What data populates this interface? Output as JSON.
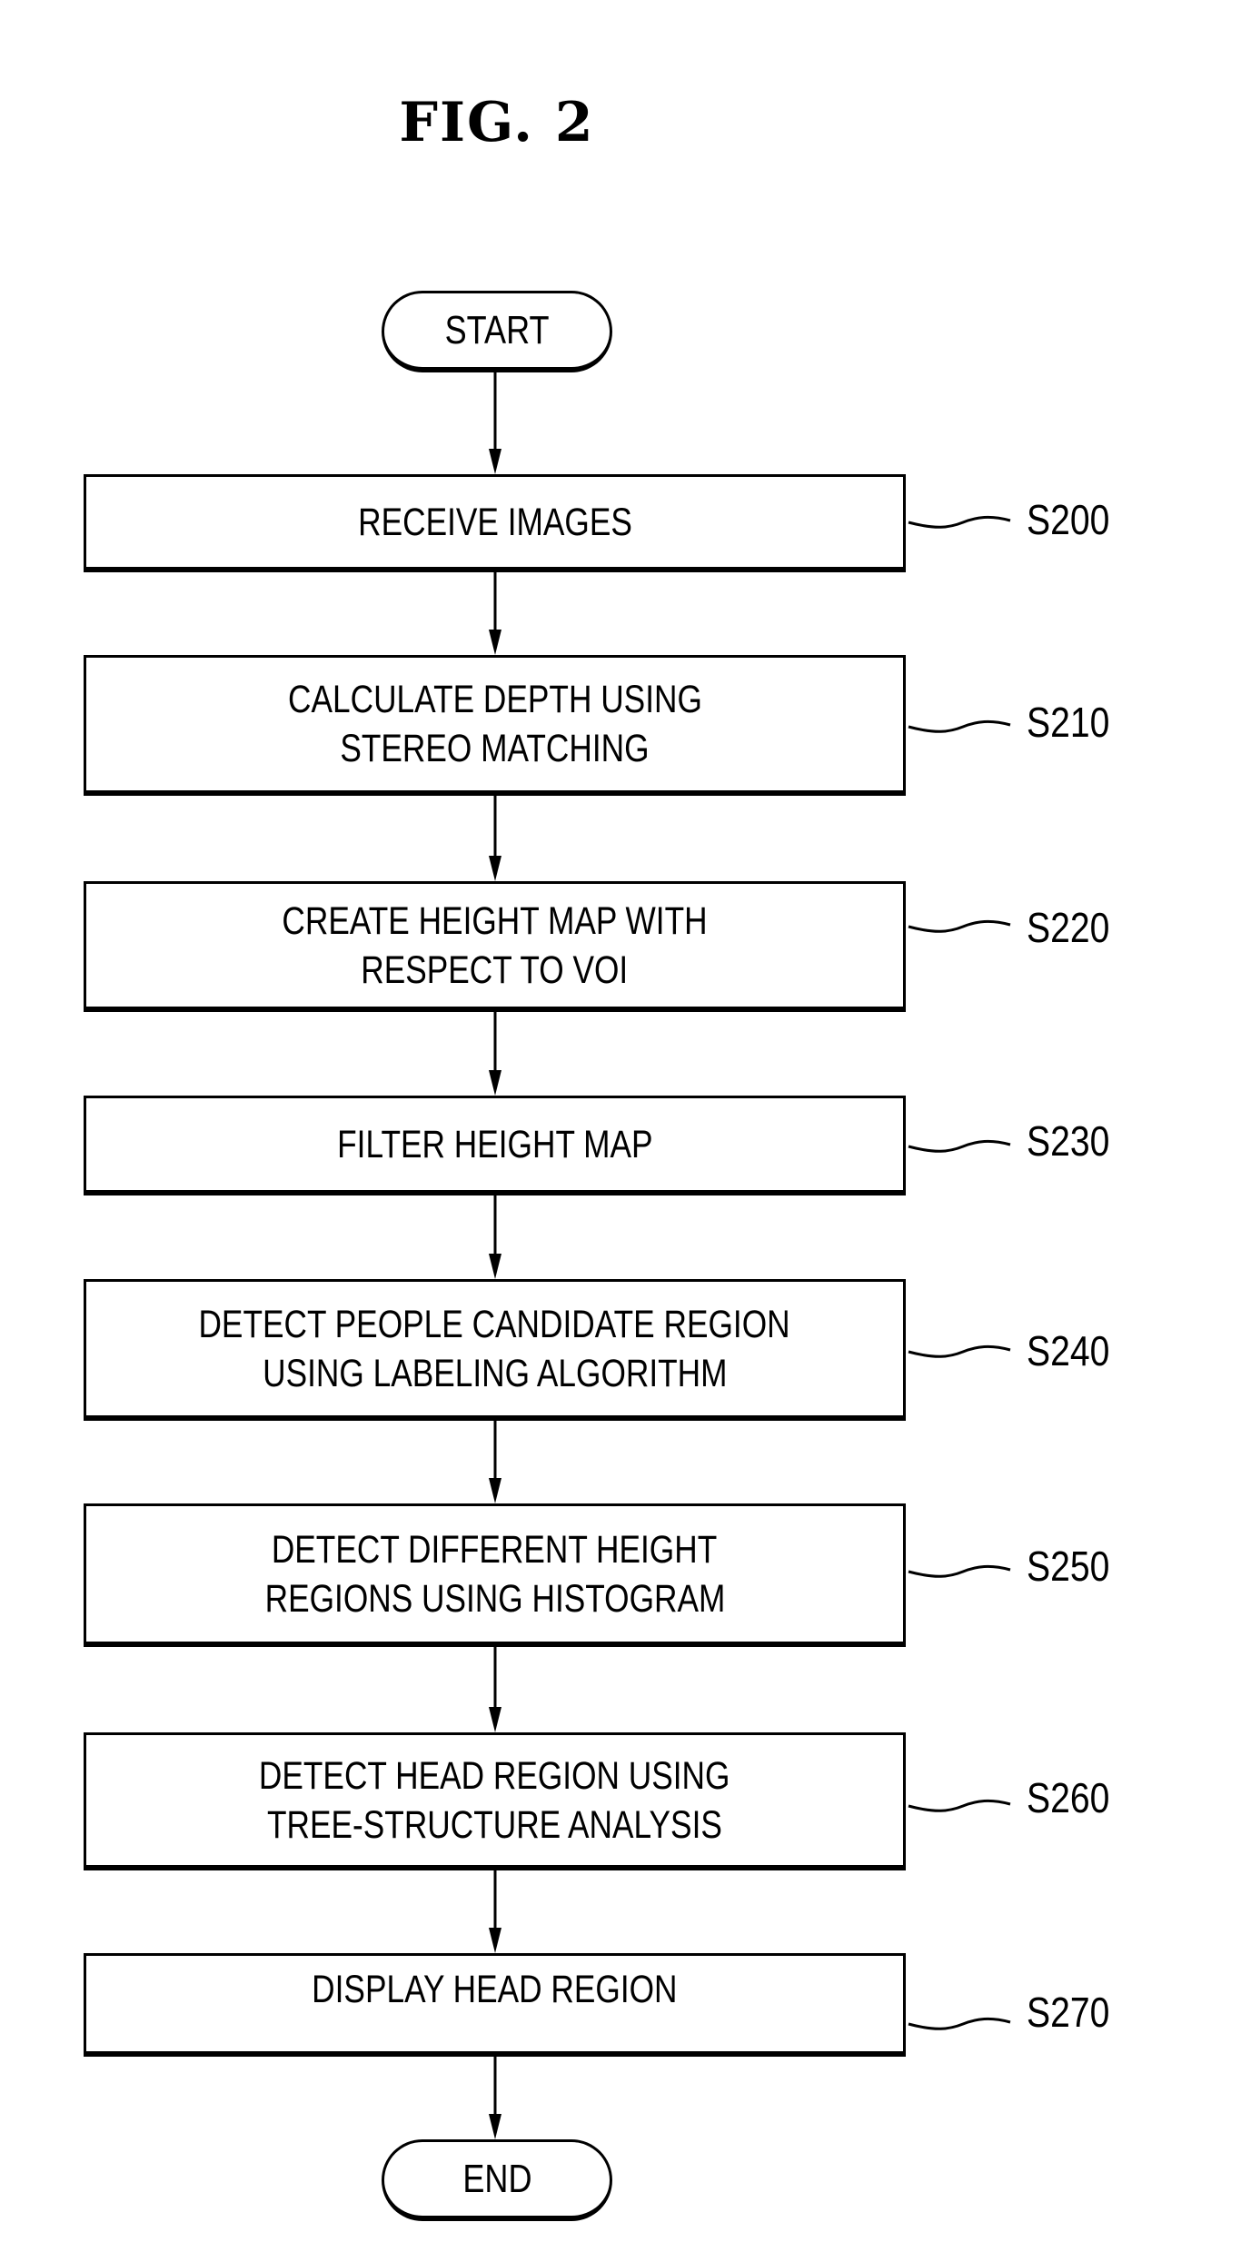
{
  "figure": {
    "title": "FIG. 2",
    "start_label": "START",
    "end_label": "END",
    "steps": [
      {
        "id": "S200",
        "lines": [
          "RECEIVE IMAGES"
        ]
      },
      {
        "id": "S210",
        "lines": [
          "CALCULATE DEPTH USING",
          "STEREO MATCHING"
        ]
      },
      {
        "id": "S220",
        "lines": [
          "CREATE HEIGHT MAP WITH",
          "RESPECT TO VOI"
        ]
      },
      {
        "id": "S230",
        "lines": [
          "FILTER HEIGHT MAP"
        ]
      },
      {
        "id": "S240",
        "lines": [
          "DETECT PEOPLE CANDIDATE REGION",
          "USING LABELING ALGORITHM"
        ]
      },
      {
        "id": "S250",
        "lines": [
          "DETECT DIFFERENT HEIGHT",
          "REGIONS USING HISTOGRAM"
        ]
      },
      {
        "id": "S260",
        "lines": [
          "DETECT HEAD REGION USING",
          "TREE-STRUCTURE ANALYSIS"
        ]
      },
      {
        "id": "S270",
        "lines": [
          "DISPLAY HEAD REGION"
        ]
      }
    ]
  }
}
